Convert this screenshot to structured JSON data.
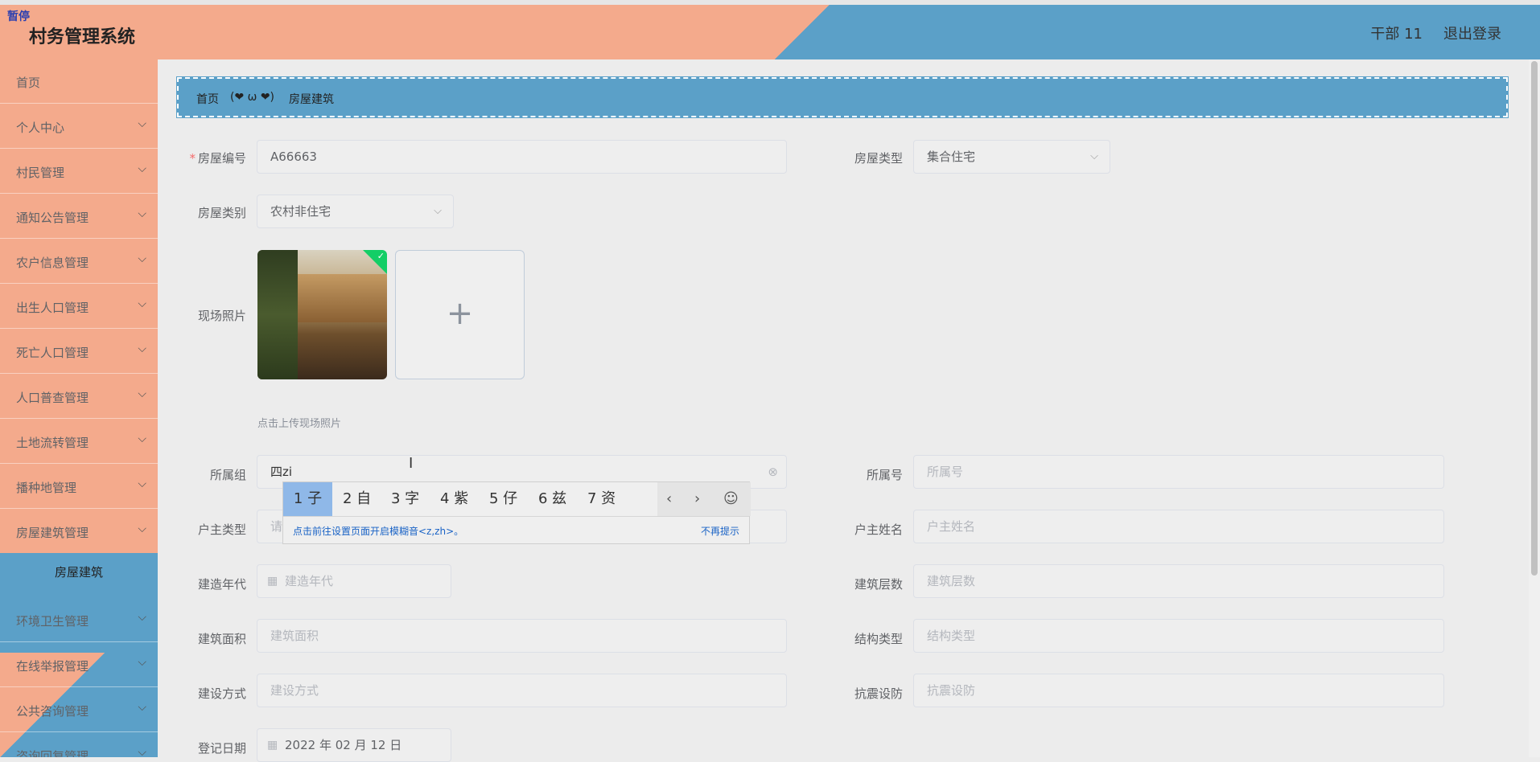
{
  "header": {
    "pause_badge": "暂停",
    "app_title": "村务管理系统",
    "user": "干部 11",
    "logout": "退出登录"
  },
  "sidebar": {
    "items": [
      {
        "label": "首页"
      },
      {
        "label": "个人中心"
      },
      {
        "label": "村民管理"
      },
      {
        "label": "通知公告管理"
      },
      {
        "label": "农户信息管理"
      },
      {
        "label": "出生人口管理"
      },
      {
        "label": "死亡人口管理"
      },
      {
        "label": "人口普查管理"
      },
      {
        "label": "土地流转管理"
      },
      {
        "label": "播种地管理"
      },
      {
        "label": "房屋建筑管理"
      },
      {
        "label": "环境卫生管理"
      },
      {
        "label": "在线举报管理"
      },
      {
        "label": "公共咨询管理"
      },
      {
        "label": "咨询回复管理"
      }
    ],
    "active_sub": "房屋建筑",
    "chevron": "chevron-down-icon"
  },
  "breadcrumb": {
    "home": "首页",
    "separator": "(❤ ω ❤)",
    "current": "房屋建筑"
  },
  "form": {
    "house_no": {
      "label": "房屋编号",
      "value": "A66663",
      "required": true
    },
    "house_type": {
      "label": "房屋类型",
      "value": "集合住宅"
    },
    "house_category": {
      "label": "房屋类别",
      "value": "农村非住宅"
    },
    "photo": {
      "label": "现场照片",
      "hint": "点击上传现场照片",
      "add": "+"
    },
    "group": {
      "label": "所属组",
      "value": "四zi"
    },
    "house_num": {
      "label": "所属号",
      "placeholder": "所属号"
    },
    "owner_type": {
      "label": "户主类型",
      "placeholder": "请"
    },
    "owner_name": {
      "label": "户主姓名",
      "placeholder": "户主姓名"
    },
    "build_year": {
      "label": "建造年代",
      "placeholder": "建造年代"
    },
    "floors": {
      "label": "建筑层数",
      "placeholder": "建筑层数"
    },
    "area": {
      "label": "建筑面积",
      "placeholder": "建筑面积"
    },
    "structure": {
      "label": "结构类型",
      "placeholder": "结构类型"
    },
    "build_method": {
      "label": "建设方式",
      "placeholder": "建设方式"
    },
    "seismic": {
      "label": "抗震设防",
      "placeholder": "抗震设防"
    },
    "reg_date": {
      "label": "登记日期",
      "value": "2022 年 02 月 12 日"
    }
  },
  "ime": {
    "candidates": [
      "1 子",
      "2 自",
      "3 字",
      "4 紫",
      "5 仔",
      "6 兹",
      "7 资"
    ],
    "prev": "‹",
    "next": "›",
    "emoji": "☺",
    "tip": "点击前往设置页面开启模糊音<z,zh>。",
    "dismiss": "不再提示"
  }
}
